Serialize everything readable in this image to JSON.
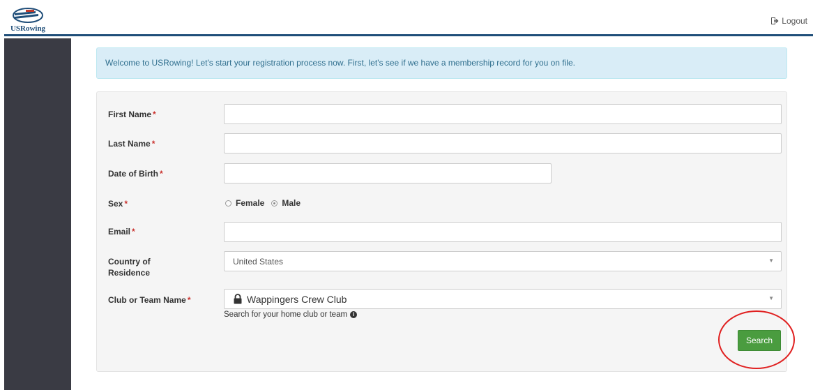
{
  "header": {
    "logo_text": "USRowing",
    "logout_label": "Logout"
  },
  "alert": {
    "text": "Welcome to USRowing! Let's start your registration process now. First, let's see if we have a membership record for you on file."
  },
  "form": {
    "first_name": {
      "label": "First Name",
      "value": ""
    },
    "last_name": {
      "label": "Last Name",
      "value": ""
    },
    "dob": {
      "label": "Date of Birth",
      "value": ""
    },
    "sex": {
      "label": "Sex",
      "options": [
        {
          "label": "Female",
          "selected": false
        },
        {
          "label": "Male",
          "selected": true
        }
      ]
    },
    "email": {
      "label": "Email",
      "value": ""
    },
    "country": {
      "label_line1": "Country of",
      "label_line2": "Residence",
      "value": "United States"
    },
    "club": {
      "label": "Club or Team Name",
      "value": "Wappingers Crew Club",
      "help": "Search for your home club or team"
    },
    "required_mark": "*",
    "search_label": "Search"
  },
  "colors": {
    "header_border": "#1f4e79",
    "sidebar": "#3a3b44",
    "alert_bg": "#d9edf7",
    "alert_text": "#31708f",
    "primary_button": "#4a9c3f",
    "annotation_circle": "#e02020"
  }
}
